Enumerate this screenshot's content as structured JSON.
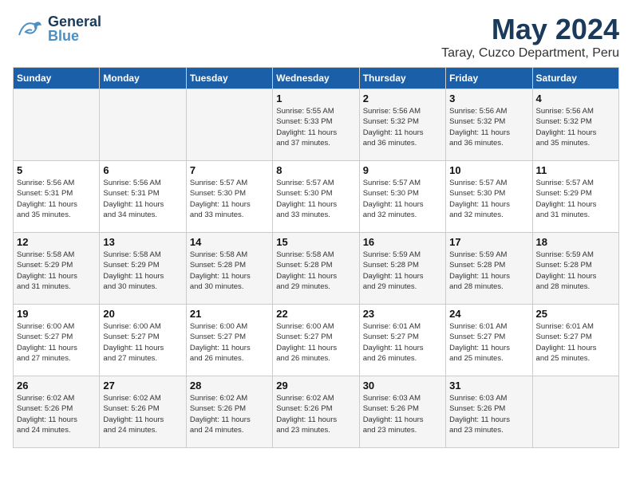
{
  "header": {
    "logo": {
      "general": "General",
      "blue": "Blue"
    },
    "month": "May 2024",
    "location": "Taray, Cuzco Department, Peru"
  },
  "columns": [
    "Sunday",
    "Monday",
    "Tuesday",
    "Wednesday",
    "Thursday",
    "Friday",
    "Saturday"
  ],
  "weeks": [
    [
      {
        "day": "",
        "info": ""
      },
      {
        "day": "",
        "info": ""
      },
      {
        "day": "",
        "info": ""
      },
      {
        "day": "1",
        "info": "Sunrise: 5:55 AM\nSunset: 5:33 PM\nDaylight: 11 hours\nand 37 minutes."
      },
      {
        "day": "2",
        "info": "Sunrise: 5:56 AM\nSunset: 5:32 PM\nDaylight: 11 hours\nand 36 minutes."
      },
      {
        "day": "3",
        "info": "Sunrise: 5:56 AM\nSunset: 5:32 PM\nDaylight: 11 hours\nand 36 minutes."
      },
      {
        "day": "4",
        "info": "Sunrise: 5:56 AM\nSunset: 5:32 PM\nDaylight: 11 hours\nand 35 minutes."
      }
    ],
    [
      {
        "day": "5",
        "info": "Sunrise: 5:56 AM\nSunset: 5:31 PM\nDaylight: 11 hours\nand 35 minutes."
      },
      {
        "day": "6",
        "info": "Sunrise: 5:56 AM\nSunset: 5:31 PM\nDaylight: 11 hours\nand 34 minutes."
      },
      {
        "day": "7",
        "info": "Sunrise: 5:57 AM\nSunset: 5:30 PM\nDaylight: 11 hours\nand 33 minutes."
      },
      {
        "day": "8",
        "info": "Sunrise: 5:57 AM\nSunset: 5:30 PM\nDaylight: 11 hours\nand 33 minutes."
      },
      {
        "day": "9",
        "info": "Sunrise: 5:57 AM\nSunset: 5:30 PM\nDaylight: 11 hours\nand 32 minutes."
      },
      {
        "day": "10",
        "info": "Sunrise: 5:57 AM\nSunset: 5:30 PM\nDaylight: 11 hours\nand 32 minutes."
      },
      {
        "day": "11",
        "info": "Sunrise: 5:57 AM\nSunset: 5:29 PM\nDaylight: 11 hours\nand 31 minutes."
      }
    ],
    [
      {
        "day": "12",
        "info": "Sunrise: 5:58 AM\nSunset: 5:29 PM\nDaylight: 11 hours\nand 31 minutes."
      },
      {
        "day": "13",
        "info": "Sunrise: 5:58 AM\nSunset: 5:29 PM\nDaylight: 11 hours\nand 30 minutes."
      },
      {
        "day": "14",
        "info": "Sunrise: 5:58 AM\nSunset: 5:28 PM\nDaylight: 11 hours\nand 30 minutes."
      },
      {
        "day": "15",
        "info": "Sunrise: 5:58 AM\nSunset: 5:28 PM\nDaylight: 11 hours\nand 29 minutes."
      },
      {
        "day": "16",
        "info": "Sunrise: 5:59 AM\nSunset: 5:28 PM\nDaylight: 11 hours\nand 29 minutes."
      },
      {
        "day": "17",
        "info": "Sunrise: 5:59 AM\nSunset: 5:28 PM\nDaylight: 11 hours\nand 28 minutes."
      },
      {
        "day": "18",
        "info": "Sunrise: 5:59 AM\nSunset: 5:28 PM\nDaylight: 11 hours\nand 28 minutes."
      }
    ],
    [
      {
        "day": "19",
        "info": "Sunrise: 6:00 AM\nSunset: 5:27 PM\nDaylight: 11 hours\nand 27 minutes."
      },
      {
        "day": "20",
        "info": "Sunrise: 6:00 AM\nSunset: 5:27 PM\nDaylight: 11 hours\nand 27 minutes."
      },
      {
        "day": "21",
        "info": "Sunrise: 6:00 AM\nSunset: 5:27 PM\nDaylight: 11 hours\nand 26 minutes."
      },
      {
        "day": "22",
        "info": "Sunrise: 6:00 AM\nSunset: 5:27 PM\nDaylight: 11 hours\nand 26 minutes."
      },
      {
        "day": "23",
        "info": "Sunrise: 6:01 AM\nSunset: 5:27 PM\nDaylight: 11 hours\nand 26 minutes."
      },
      {
        "day": "24",
        "info": "Sunrise: 6:01 AM\nSunset: 5:27 PM\nDaylight: 11 hours\nand 25 minutes."
      },
      {
        "day": "25",
        "info": "Sunrise: 6:01 AM\nSunset: 5:27 PM\nDaylight: 11 hours\nand 25 minutes."
      }
    ],
    [
      {
        "day": "26",
        "info": "Sunrise: 6:02 AM\nSunset: 5:26 PM\nDaylight: 11 hours\nand 24 minutes."
      },
      {
        "day": "27",
        "info": "Sunrise: 6:02 AM\nSunset: 5:26 PM\nDaylight: 11 hours\nand 24 minutes."
      },
      {
        "day": "28",
        "info": "Sunrise: 6:02 AM\nSunset: 5:26 PM\nDaylight: 11 hours\nand 24 minutes."
      },
      {
        "day": "29",
        "info": "Sunrise: 6:02 AM\nSunset: 5:26 PM\nDaylight: 11 hours\nand 23 minutes."
      },
      {
        "day": "30",
        "info": "Sunrise: 6:03 AM\nSunset: 5:26 PM\nDaylight: 11 hours\nand 23 minutes."
      },
      {
        "day": "31",
        "info": "Sunrise: 6:03 AM\nSunset: 5:26 PM\nDaylight: 11 hours\nand 23 minutes."
      },
      {
        "day": "",
        "info": ""
      }
    ]
  ]
}
